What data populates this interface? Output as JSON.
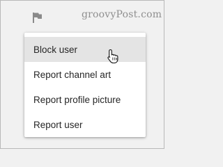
{
  "header": {
    "flag_icon": "flag-icon",
    "watermark": "groovyPost.com"
  },
  "menu": {
    "items": [
      {
        "label": "Block user",
        "hovered": true
      },
      {
        "label": "Report channel art",
        "hovered": false
      },
      {
        "label": "Report profile picture",
        "hovered": false
      },
      {
        "label": "Report user",
        "hovered": false
      }
    ]
  },
  "cursor": {
    "icon": "hand-pointer-icon"
  },
  "colors": {
    "background": "#f1f1f1",
    "menu_background": "#ffffff",
    "hover_background": "#e4e4e4",
    "text": "#262626",
    "watermark": "#8f8f8f",
    "flag": "#8a8a8a"
  }
}
